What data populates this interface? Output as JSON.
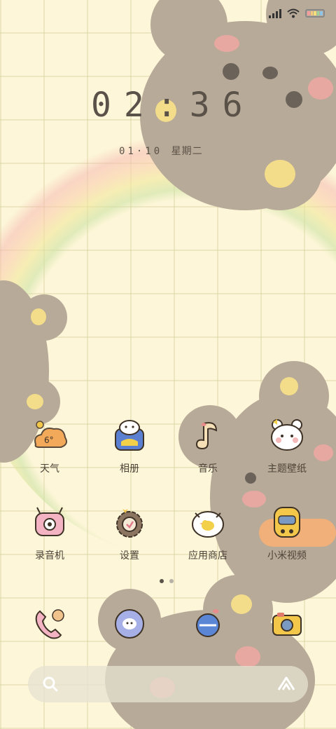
{
  "status_bar": {
    "signal_icon": "signal-icon",
    "wifi_icon": "wifi-icon",
    "battery_icon": "battery-icon"
  },
  "clock": {
    "time": "02:36",
    "date": "01·10",
    "weekday": "星期二"
  },
  "apps_row1": [
    {
      "label": "天气",
      "icon": "weather-icon"
    },
    {
      "label": "相册",
      "icon": "gallery-icon"
    },
    {
      "label": "音乐",
      "icon": "music-icon"
    },
    {
      "label": "主题壁纸",
      "icon": "themes-icon"
    }
  ],
  "apps_row2": [
    {
      "label": "录音机",
      "icon": "recorder-icon"
    },
    {
      "label": "设置",
      "icon": "settings-icon"
    },
    {
      "label": "应用商店",
      "icon": "app-store-icon"
    },
    {
      "label": "小米视频",
      "icon": "video-icon"
    }
  ],
  "dock": [
    {
      "icon": "phone-icon"
    },
    {
      "icon": "messages-icon"
    },
    {
      "icon": "browser-icon"
    },
    {
      "icon": "camera-icon"
    }
  ],
  "weather_temp": "6°",
  "page_indicator": {
    "pages": 2,
    "current": 1
  },
  "search_bar": {
    "left_icon": "search-icon",
    "right_icon": "voice-assistant-icon"
  },
  "colors": {
    "text": "#4d4438",
    "bear": "#b8aa98",
    "background": "#fdf6d8"
  }
}
